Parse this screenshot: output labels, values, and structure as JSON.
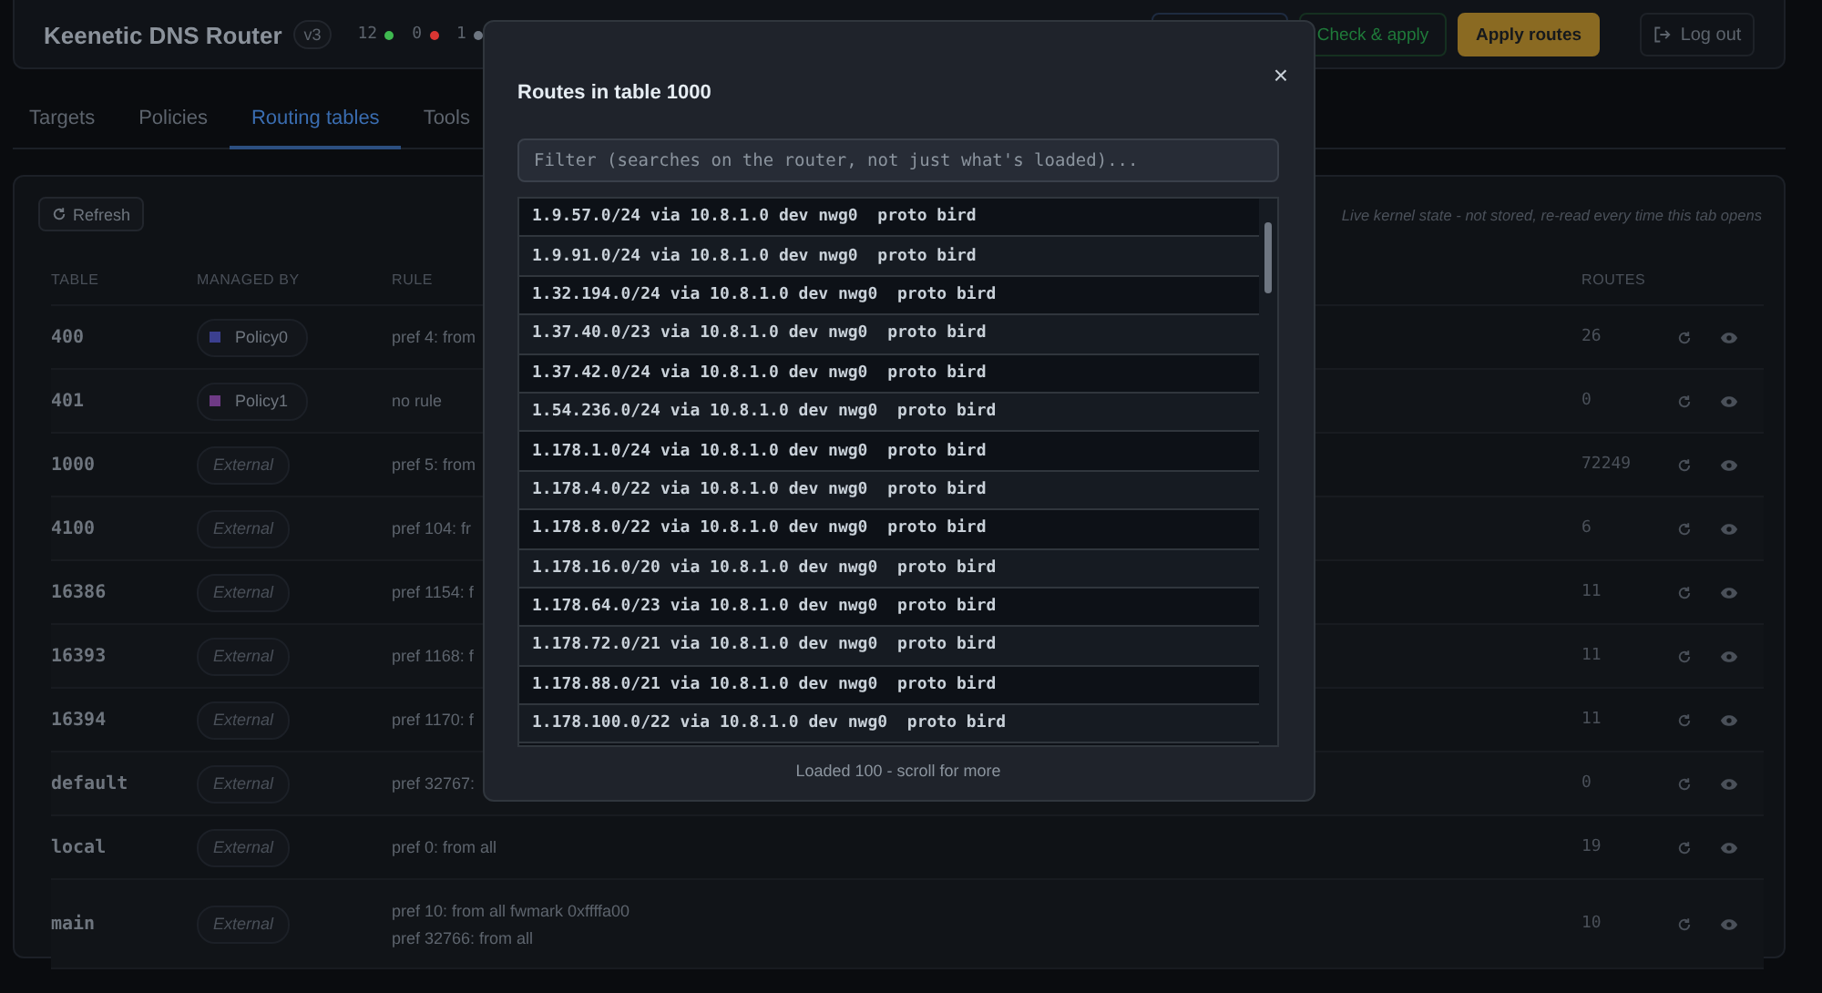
{
  "header": {
    "title": "Keenetic DNS Router",
    "version": "v3",
    "stats": [
      {
        "count": "12",
        "color": "#3fb950"
      },
      {
        "count": "0",
        "color": "#da3633"
      },
      {
        "count": "1",
        "color": "#6e7681"
      }
    ],
    "buttons": [
      {
        "kind": "outline"
      },
      {
        "label": "Check & apply",
        "kind": "success"
      },
      {
        "label": "Apply routes",
        "kind": "primary"
      },
      {
        "label": "Log out",
        "kind": "logout"
      }
    ]
  },
  "tabs": [
    {
      "label": "Targets",
      "selected": false
    },
    {
      "label": "Policies",
      "selected": false
    },
    {
      "label": "Routing tables",
      "selected": true
    },
    {
      "label": "Tools",
      "selected": false
    }
  ],
  "panel": {
    "refresh": "Refresh",
    "note": "Live kernel state - not stored, re-read every time this tab opens",
    "columns": [
      "TABLE",
      "MANAGED BY",
      "RULE",
      "ROUTES"
    ],
    "rows": [
      {
        "table": "400",
        "managed_by": {
          "kind": "policy",
          "label": "Policy0",
          "color": "#3b3f8f"
        },
        "rule": [
          "pref 4: from"
        ],
        "routes": "26"
      },
      {
        "table": "401",
        "managed_by": {
          "kind": "policy",
          "label": "Policy1",
          "color": "#6e3a85"
        },
        "rule": [
          "no rule"
        ],
        "routes": "0"
      },
      {
        "table": "1000",
        "managed_by": {
          "kind": "external",
          "label": "External"
        },
        "rule": [
          "pref 5: from"
        ],
        "routes": "72249"
      },
      {
        "table": "4100",
        "managed_by": {
          "kind": "external",
          "label": "External"
        },
        "rule": [
          "pref 104: fr"
        ],
        "routes": "6"
      },
      {
        "table": "16386",
        "managed_by": {
          "kind": "external",
          "label": "External"
        },
        "rule": [
          "pref 1154: f"
        ],
        "routes": "11"
      },
      {
        "table": "16393",
        "managed_by": {
          "kind": "external",
          "label": "External"
        },
        "rule": [
          "pref 1168: f"
        ],
        "routes": "11"
      },
      {
        "table": "16394",
        "managed_by": {
          "kind": "external",
          "label": "External"
        },
        "rule": [
          "pref 1170: f"
        ],
        "routes": "11"
      },
      {
        "table": "default",
        "managed_by": {
          "kind": "external",
          "label": "External"
        },
        "rule": [
          "pref 32767:"
        ],
        "routes": "0"
      },
      {
        "table": "local",
        "managed_by": {
          "kind": "external",
          "label": "External"
        },
        "rule": [
          "pref 0: from all"
        ],
        "routes": "19"
      },
      {
        "table": "main",
        "managed_by": {
          "kind": "external",
          "label": "External"
        },
        "rule": [
          "pref 10: from all fwmark 0xffffa00",
          "pref 32766: from all"
        ],
        "routes": "10"
      }
    ]
  },
  "modal": {
    "title": "Routes in table 1000",
    "close": "×",
    "filter_placeholder": "Filter (searches on the router, not just what's loaded)...",
    "routes": [
      "1.9.57.0/24 via 10.8.1.0 dev nwg0  proto bird",
      "1.9.91.0/24 via 10.8.1.0 dev nwg0  proto bird",
      "1.32.194.0/24 via 10.8.1.0 dev nwg0  proto bird",
      "1.37.40.0/23 via 10.8.1.0 dev nwg0  proto bird",
      "1.37.42.0/24 via 10.8.1.0 dev nwg0  proto bird",
      "1.54.236.0/24 via 10.8.1.0 dev nwg0  proto bird",
      "1.178.1.0/24 via 10.8.1.0 dev nwg0  proto bird",
      "1.178.4.0/22 via 10.8.1.0 dev nwg0  proto bird",
      "1.178.8.0/22 via 10.8.1.0 dev nwg0  proto bird",
      "1.178.16.0/20 via 10.8.1.0 dev nwg0  proto bird",
      "1.178.64.0/23 via 10.8.1.0 dev nwg0  proto bird",
      "1.178.72.0/21 via 10.8.1.0 dev nwg0  proto bird",
      "1.178.88.0/21 via 10.8.1.0 dev nwg0  proto bird",
      "1.178.100.0/22 via 10.8.1.0 dev nwg0  proto bird"
    ],
    "footer": "Loaded 100 - scroll for more"
  }
}
